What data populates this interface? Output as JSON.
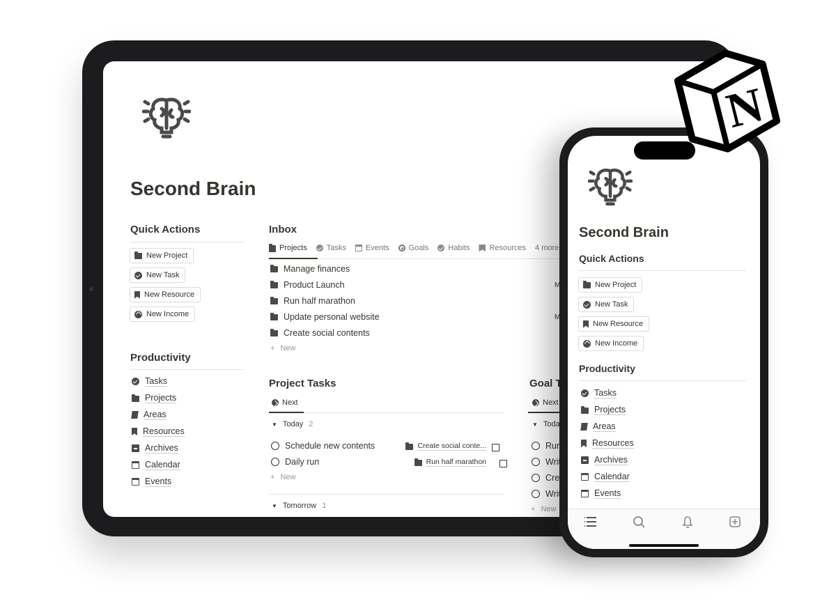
{
  "page": {
    "title": "Second Brain"
  },
  "quick_actions": {
    "heading": "Quick Actions",
    "buttons": [
      {
        "label": "New Project",
        "icon": "folder-icon"
      },
      {
        "label": "New Task",
        "icon": "check-circle-icon"
      },
      {
        "label": "New Resource",
        "icon": "bookmark-icon"
      },
      {
        "label": "New Income",
        "icon": "arrow-up-circle-icon"
      }
    ]
  },
  "productivity": {
    "heading": "Productivity",
    "items": [
      {
        "label": "Tasks",
        "icon": "check-circle-icon"
      },
      {
        "label": "Projects",
        "icon": "folder-icon"
      },
      {
        "label": "Areas",
        "icon": "areas-icon"
      },
      {
        "label": "Resources",
        "icon": "bookmark-icon"
      },
      {
        "label": "Archives",
        "icon": "archive-icon"
      },
      {
        "label": "Calendar",
        "icon": "calendar-icon"
      },
      {
        "label": "Events",
        "icon": "calendar-grid-icon"
      }
    ]
  },
  "inbox": {
    "heading": "Inbox",
    "tabs": [
      {
        "label": "Projects",
        "icon": "folder-icon",
        "active": true
      },
      {
        "label": "Tasks",
        "icon": "check-circle-icon"
      },
      {
        "label": "Events",
        "icon": "calendar-icon"
      },
      {
        "label": "Goals",
        "icon": "target-icon"
      },
      {
        "label": "Habits",
        "icon": "badge-check-icon"
      },
      {
        "label": "Resources",
        "icon": "bookmark-icon"
      }
    ],
    "more": "4 more",
    "rows": [
      "Manage finances",
      "Product Launch",
      "Run half marathon",
      "Update personal website",
      "Create social contents"
    ],
    "row_partial": [
      "",
      "M",
      "",
      "M",
      ""
    ],
    "new_label": "New"
  },
  "project_tasks": {
    "heading": "Project Tasks",
    "view": "Next",
    "groups": [
      {
        "label": "Today",
        "count": "2",
        "tasks": [
          {
            "name": "Schedule new contents",
            "project": "Create social conte..."
          },
          {
            "name": "Daily run",
            "project": "Run half marathon"
          }
        ]
      },
      {
        "label": "Tomorrow",
        "count": "1"
      }
    ],
    "new_label": "New"
  },
  "goal_tasks": {
    "heading": "Goal Ta",
    "view": "Next",
    "group": "Toda",
    "tasks": [
      "Run",
      "Writ",
      "Crea",
      "Writ"
    ],
    "new_label": "New"
  },
  "phone_tabbar": [
    "list-icon",
    "search-icon",
    "bell-icon",
    "plus-square-icon"
  ],
  "logo": {
    "text": "N"
  }
}
